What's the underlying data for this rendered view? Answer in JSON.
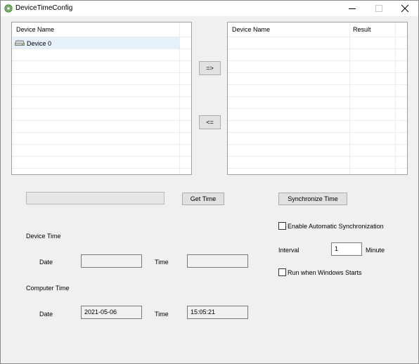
{
  "window": {
    "title": "DeviceTimeConfig"
  },
  "left_list": {
    "header": "Device Name",
    "items": [
      {
        "label": "Device 0",
        "icon": "drive-icon"
      }
    ]
  },
  "right_list": {
    "headers": [
      "Device Name",
      "Result"
    ]
  },
  "buttons": {
    "add": "=>",
    "remove": "<=",
    "get_time": "Get Time",
    "synchronize_time": "Synchronize Time"
  },
  "device_time": {
    "section_label": "Device Time",
    "date_label": "Date",
    "date_value": "",
    "time_label": "Time",
    "time_value": ""
  },
  "computer_time": {
    "section_label": "Computer Time",
    "date_label": "Date",
    "date_value": "2021-05-06",
    "time_label": "Time",
    "time_value": "15:05:21"
  },
  "auto_sync": {
    "enable_label": "Enable Automatic Synchronization",
    "enable_checked": false,
    "interval_label": "Interval",
    "interval_value": "1",
    "unit_label": "Minute",
    "run_on_start_label": "Run when Windows Starts",
    "run_on_start_checked": false
  }
}
